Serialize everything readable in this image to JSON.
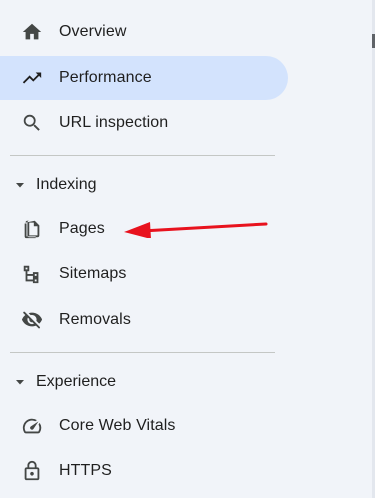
{
  "nav": {
    "overview": {
      "label": "Overview",
      "icon": "home-icon"
    },
    "performance": {
      "label": "Performance",
      "icon": "trending-up-icon",
      "active": true
    },
    "url_inspection": {
      "label": "URL inspection",
      "icon": "search-icon"
    }
  },
  "indexing": {
    "header": "Indexing",
    "items": [
      {
        "label": "Pages",
        "icon": "pages-icon"
      },
      {
        "label": "Sitemaps",
        "icon": "sitemap-icon"
      },
      {
        "label": "Removals",
        "icon": "visibility-off-icon"
      }
    ]
  },
  "experience": {
    "header": "Experience",
    "items": [
      {
        "label": "Core Web Vitals",
        "icon": "speed-gauge-icon"
      },
      {
        "label": "HTTPS",
        "icon": "lock-icon"
      }
    ]
  },
  "colors": {
    "background": "#f1f4f9",
    "active_background": "#d3e3fd",
    "arrow": "#e8121e",
    "divider": "#c4c7c5"
  }
}
